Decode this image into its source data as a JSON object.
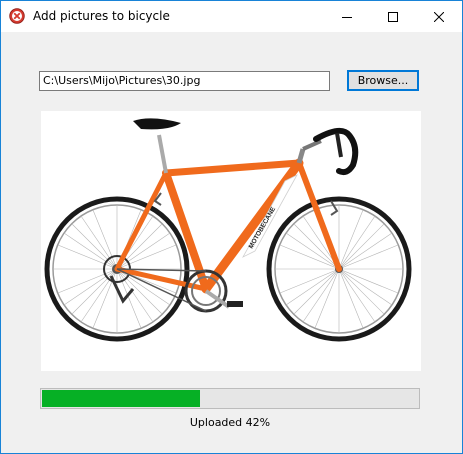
{
  "window": {
    "title": "Add pictures to bicycle",
    "icons": {
      "app": "no-entry-icon",
      "minimize": "minimize-icon",
      "maximize": "maximize-icon",
      "close": "close-icon"
    },
    "colors": {
      "border": "#1883d7"
    }
  },
  "file": {
    "path": "C:\\Users\\Mijo\\Pictures\\30.jpg",
    "browse_label": "Browse..."
  },
  "picture": {
    "bicycle_logo": "MOTOBECANE",
    "colors": {
      "frame": "#f06a1c",
      "tire": "#1a1a1a"
    }
  },
  "upload": {
    "progress": 0.42,
    "status": "Uploaded 42%",
    "color": "#06b025"
  }
}
